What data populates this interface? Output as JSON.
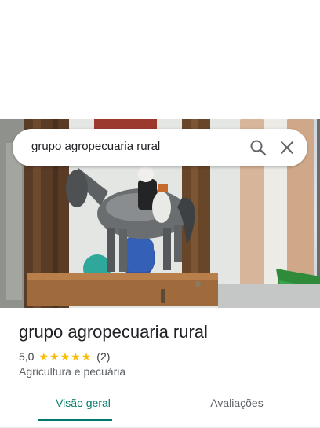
{
  "search": {
    "query": "grupo agropecuaria rural",
    "search_icon": "search-icon",
    "close_icon": "close-icon"
  },
  "place": {
    "name": "grupo agropecuaria rural",
    "rating": "5,0",
    "stars": 5,
    "review_count": "(2)",
    "category": "Agricultura e pecuária"
  },
  "tabs": [
    {
      "label": "Visão geral",
      "active": true
    },
    {
      "label": "Avaliações",
      "active": false
    }
  ],
  "colors": {
    "accent": "#00796b",
    "star": "#fbbc04",
    "text_primary": "#202124",
    "text_secondary": "#5f6368"
  }
}
